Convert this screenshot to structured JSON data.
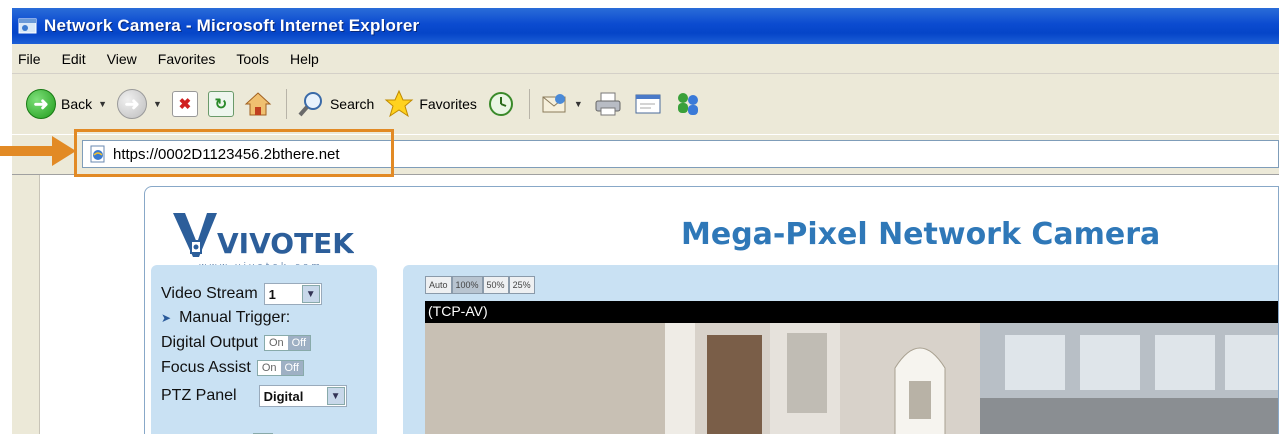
{
  "window": {
    "title": "Network Camera - Microsoft Internet Explorer"
  },
  "menu": [
    "File",
    "Edit",
    "View",
    "Favorites",
    "Tools",
    "Help"
  ],
  "toolbar": {
    "back_label": "Back",
    "search_label": "Search",
    "favorites_label": "Favorites"
  },
  "address": {
    "url": "https://0002D1123456.2bthere.net"
  },
  "camera_page": {
    "logo_text": "VIVOTEK",
    "logo_url_text": "www.vivotek.com",
    "heading": "Mega-Pixel Network Camera",
    "controls": {
      "video_stream_label": "Video Stream",
      "video_stream_value": "1",
      "manual_trigger_label": "Manual Trigger:",
      "digital_output_label": "Digital Output",
      "focus_assist_label": "Focus Assist",
      "on_label": "On",
      "off_label": "Off",
      "ptz_panel_label": "PTZ Panel",
      "ptz_panel_value": "Digital"
    },
    "video": {
      "size_buttons": [
        "Auto",
        "100%",
        "50%",
        "25%"
      ],
      "selected_size": "100%",
      "protocol": "(TCP-AV)"
    }
  },
  "colors": {
    "titlebar": "#0b4bd0",
    "heading": "#2f78b8",
    "panel": "#c9e1f3",
    "highlight": "#e28a25"
  }
}
